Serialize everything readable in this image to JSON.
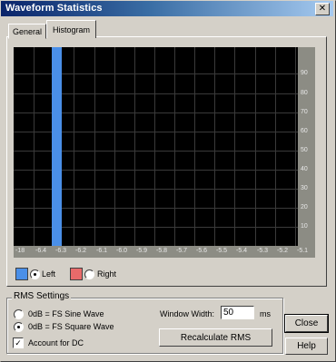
{
  "window": {
    "title": "Waveform Statistics",
    "close_glyph": "✕"
  },
  "tabs": [
    {
      "label": "General",
      "active": false
    },
    {
      "label": "Histogram",
      "active": true
    }
  ],
  "chart_data": {
    "type": "bar",
    "y_tick_labels": [
      "90",
      "80",
      "70",
      "60",
      "50",
      "40",
      "30",
      "20",
      "10"
    ],
    "x_tick_labels": [
      "-18",
      "-6.4",
      "-6.3",
      "-6.2",
      "-6.1",
      "-6.0",
      "-5.9",
      "-5.8",
      "-5.7",
      "-5.6",
      "-5.5",
      "-5.4",
      "-5.3",
      "-5.2",
      "-5.1"
    ],
    "grid": true,
    "series": [
      {
        "name": "Left",
        "color": "#4a8fe8",
        "highlighted_bin": "-6.2",
        "value_fraction_of_axis": 1.0
      }
    ],
    "right_series_color": "#e86a6a"
  },
  "legend": {
    "left_label": "Left",
    "right_label": "Right",
    "selected": "Left"
  },
  "rms": {
    "group_title": "RMS Settings",
    "option_sine": "0dB = FS Sine Wave",
    "option_square": "0dB = FS Square Wave",
    "selected": "square",
    "account_dc_label": "Account for DC",
    "account_dc_checked": true,
    "window_width_label": "Window Width:",
    "window_width_value": "50",
    "window_width_unit": "ms",
    "recalculate_label": "Recalculate RMS"
  },
  "buttons": {
    "close": "Close",
    "help": "Help"
  }
}
